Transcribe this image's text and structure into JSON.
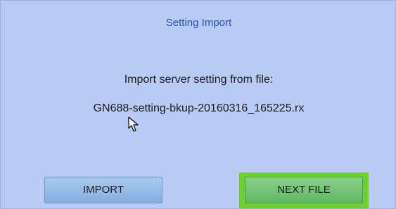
{
  "dialog": {
    "title": "Setting Import",
    "message": "Import server setting from file:",
    "filename": "GN688-setting-bkup-20160316_165225.rx"
  },
  "buttons": {
    "import_label": "IMPORT",
    "next_file_label": "NEXT FILE"
  },
  "colors": {
    "background": "#b9cbf5",
    "title_text": "#2a4fae",
    "focus_highlight": "#6cd12a",
    "import_button": "#94b8e8",
    "next_file_button": "#72c474"
  },
  "icons": {
    "pointer": "mouse-pointer-icon"
  }
}
